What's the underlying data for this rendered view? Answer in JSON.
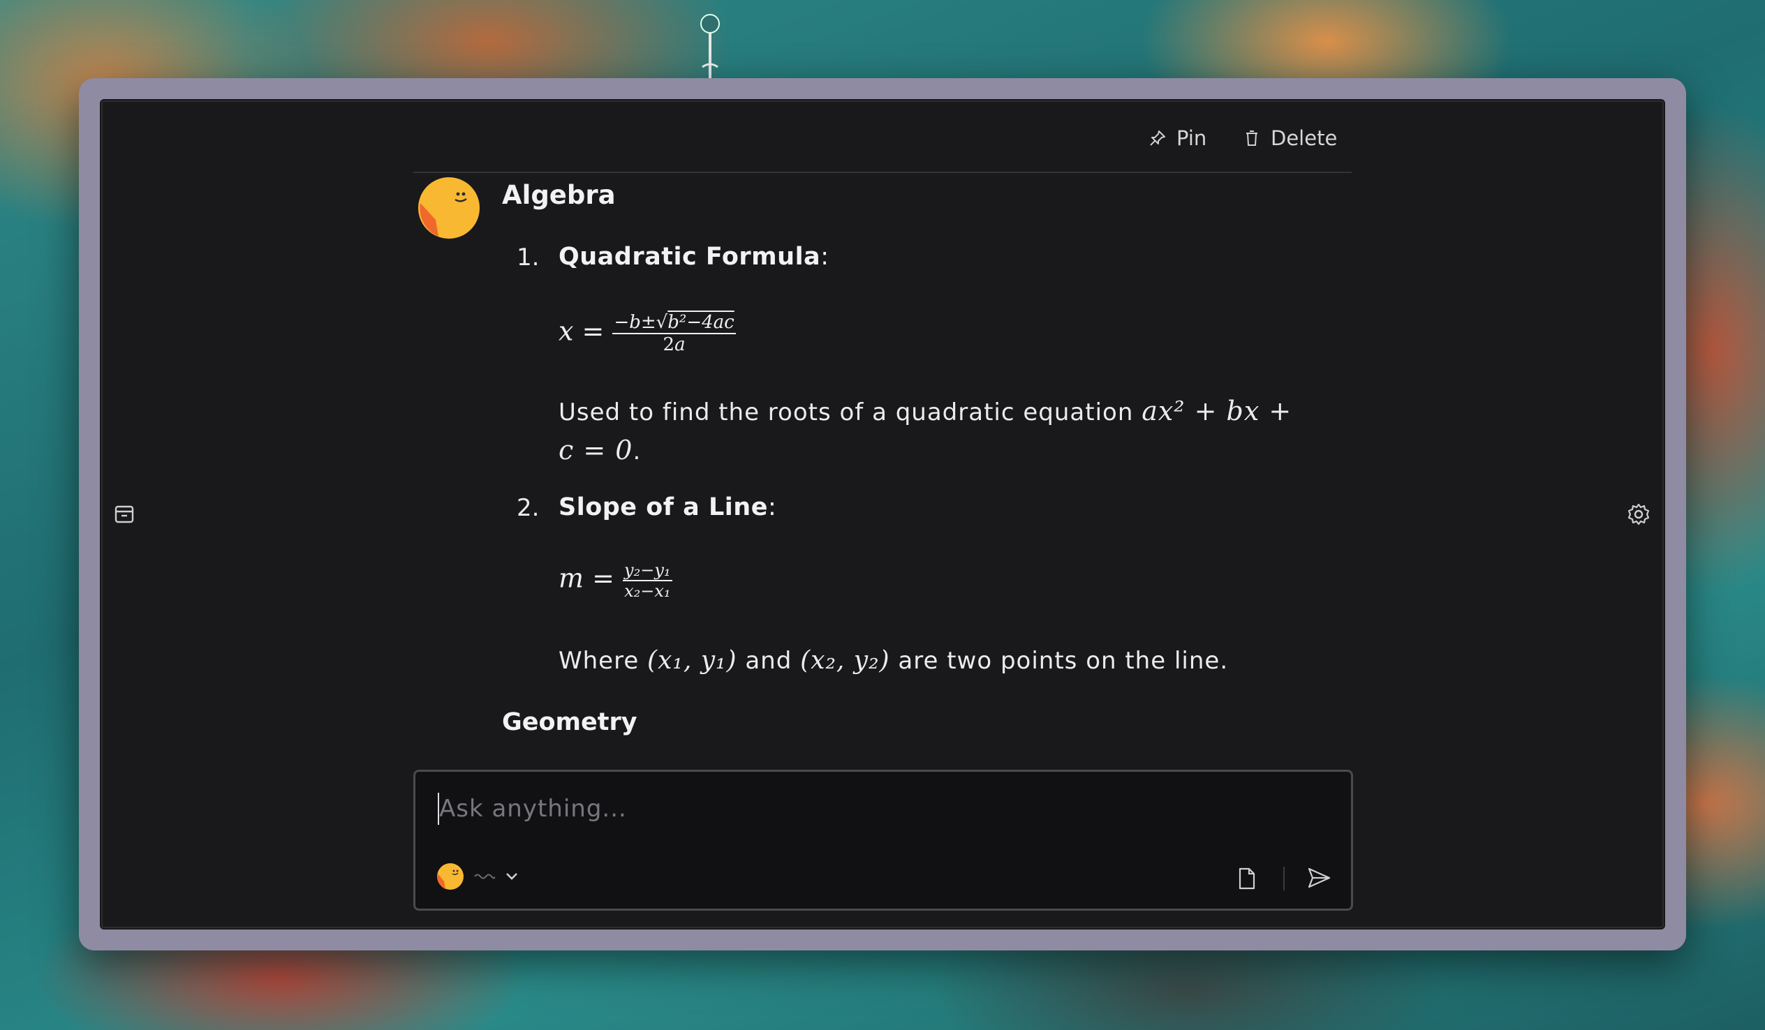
{
  "toolbar": {
    "pin_label": "Pin",
    "delete_label": "Delete"
  },
  "message": {
    "sender": "Algebra",
    "items": [
      {
        "number": "1.",
        "title": "Quadratic Formula",
        "colon": ":",
        "formula": "x = (−b ± √(b² − 4ac)) / 2a",
        "description_line1": "Used to find the roots of a quadratic equation",
        "description_line2_tail": "."
      },
      {
        "number": "2.",
        "title": "Slope of a Line",
        "colon": ":",
        "formula": "m = (y₂ − y₁) / (x₂ − x₁)",
        "description_prefix": "Where",
        "description_mid": "and",
        "description_suffix": "are two points on the line."
      }
    ],
    "next_section": "Geometry"
  },
  "composer": {
    "placeholder": "Ask anything..."
  },
  "icons": {
    "pin": "pin-icon",
    "delete": "trash-icon",
    "archive": "archive-icon",
    "settings": "gear-icon",
    "attach": "file-icon",
    "send": "send-icon",
    "model": "smiley-avatar-icon"
  },
  "colors": {
    "avatar": "#f8b832",
    "avatar_accent": "#f0682a",
    "window_frame": "#8e8ba3",
    "panel_bg": "#19191b"
  }
}
